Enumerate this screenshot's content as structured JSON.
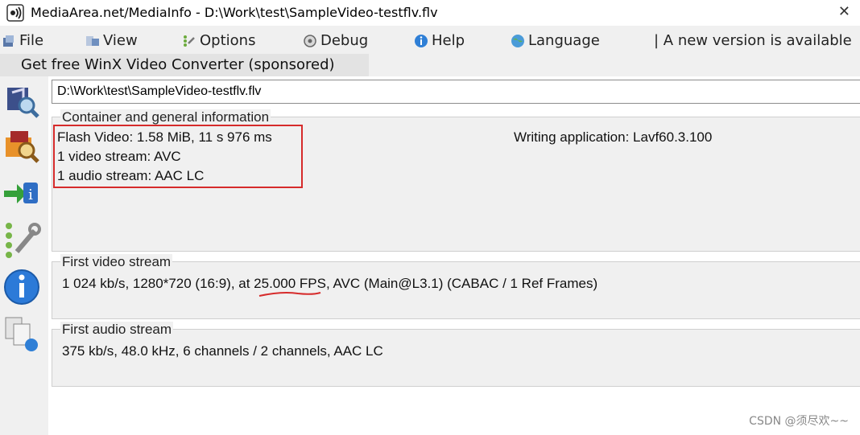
{
  "window": {
    "title": "MediaArea.net/MediaInfo - D:\\Work\\test\\SampleVideo-testflv.flv",
    "close_glyph": "✕"
  },
  "menu": {
    "items": [
      {
        "label": "File",
        "icon": "file-icon"
      },
      {
        "label": "View",
        "icon": "view-icon"
      },
      {
        "label": "Options",
        "icon": "options-icon"
      },
      {
        "label": "Debug",
        "icon": "debug-icon"
      },
      {
        "label": "Help",
        "icon": "help-icon"
      },
      {
        "label": "Language",
        "icon": "globe-icon"
      }
    ],
    "news": "| A new version is available"
  },
  "sponsor": {
    "label": "Get free WinX Video Converter (sponsored)"
  },
  "path": {
    "value": "D:\\Work\\test\\SampleVideo-testflv.flv"
  },
  "general": {
    "legend": "Container and general information",
    "lines": [
      "Flash Video: 1.58 MiB, 11 s 976 ms",
      "1 video stream: AVC",
      "1 audio stream: AAC LC"
    ],
    "writing_app": "Writing application: Lavf60.3.100"
  },
  "video": {
    "legend": "First video stream",
    "line": "1 024 kb/s, 1280*720 (16:9), at 25.000 FPS, AVC (Main@L3.1) (CABAC / 1 Ref Frames)"
  },
  "audio": {
    "legend": "First audio stream",
    "line": "375 kb/s, 48.0 kHz, 6 channels  / 2 channels, AAC LC"
  },
  "watermark": "CSDN @须尽欢~~",
  "colors": {
    "annotation": "#d62b2b",
    "panel": "#f0f0f0",
    "background": "#ffffff"
  }
}
